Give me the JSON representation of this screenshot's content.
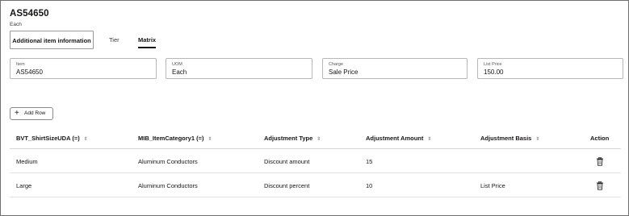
{
  "header": {
    "title": "AS54650",
    "subtitle": "Each"
  },
  "tabs": [
    {
      "label": "Additional item information"
    },
    {
      "label": "Tier"
    },
    {
      "label": "Matrix"
    }
  ],
  "fields": [
    {
      "label": "Item",
      "value": "AS54650"
    },
    {
      "label": "UOM",
      "value": "Each"
    },
    {
      "label": "Charge",
      "value": "Sale Price"
    },
    {
      "label": "List Price",
      "value": "150.00"
    }
  ],
  "add_row": {
    "label": "Add Row",
    "icon": "plus-icon"
  },
  "table": {
    "columns": [
      "BVT_ShirtSizeUDA (=)",
      "MIB_ItemCategory1 (=)",
      "Adjustment Type",
      "Adjustment Amount",
      "Adjustment Basis",
      "Action"
    ],
    "rows": [
      [
        "Medium",
        "Aluminum Conductors",
        "Discount amount",
        "15",
        ""
      ],
      [
        "Large",
        "Aluminum Conductors",
        "Discount percent",
        "10",
        "List Price"
      ]
    ],
    "sort_icon": "sort-icon",
    "action_icon": "trash-icon"
  }
}
